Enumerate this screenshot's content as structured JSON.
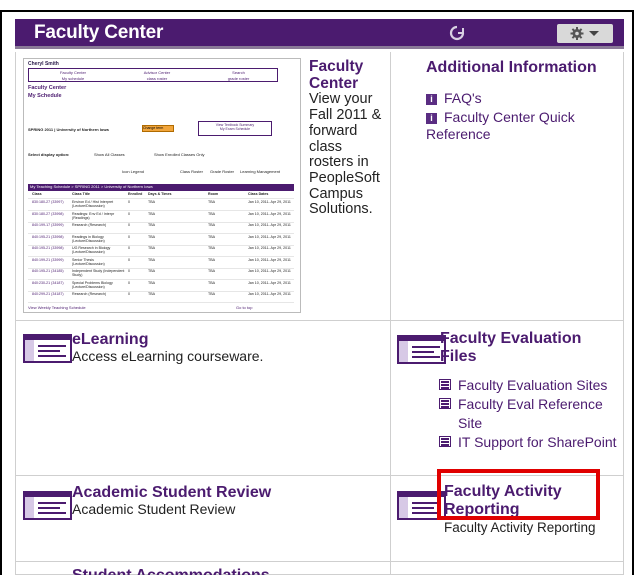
{
  "header": {
    "title": "Faculty Center"
  },
  "thumbnail": {
    "name": "Cheryl Smith",
    "tabs": [
      "Faculty Center",
      "Advisor Center",
      "Search",
      "My schedule",
      "class roster",
      "grade roster"
    ],
    "heading1": "Faculty Center",
    "heading2": "My Schedule",
    "term": "SPRING 2011 | University of Northern Iowa",
    "change_term": "Change term",
    "box1": "View Textbook Summary",
    "box2": "My Exam Schedule",
    "display_option": "Select display option:",
    "opt1": "Show All Classes",
    "opt2": "Show Enrolled Classes Only",
    "legend": "Icon Legend",
    "legend2": "Class Roster",
    "legend3": "Grade Roster",
    "legend4": "Learning Management",
    "table_title": "My Teaching Schedule > SPRING 2011 > University of Northern Iowa",
    "cols": [
      "Class",
      "Class Title",
      "Enrolled",
      "Days & Times",
      "Room",
      "Class Dates"
    ],
    "rows": [
      [
        "830:180-27 (33997)",
        "Environ Ed / Hist Interpret (Lecture/Discussion)",
        "0",
        "TBA",
        "TBA",
        "Jan 10, 2011- Apr 29, 2011"
      ],
      [
        "830:180-27 (33998)",
        "Readings: Env Ed / Interpr (Readings)",
        "0",
        "TBA",
        "TBA",
        "Jan 10, 2011- Apr 29, 2011"
      ],
      [
        "840:199-17 (33999)",
        "Research (Research)",
        "0",
        "TBA",
        "TBA",
        "Jan 10, 2011- Apr 29, 2011"
      ],
      [
        "840:195-21 (33998)",
        "Readings in Biology (Lecture/Discussion)",
        "0",
        "TBA",
        "TBA",
        "Jan 10, 2011- Apr 29, 2011"
      ],
      [
        "840:195-21 (33998)",
        "UG Research in Biology (Lecture/Discussion)",
        "0",
        "TBA",
        "TBA",
        "Jan 10, 2011- Apr 29, 2011"
      ],
      [
        "840:199-21 (33999)",
        "Senior Thesis (Lecture/Discussion)",
        "0",
        "TBA",
        "TBA",
        "Jan 10, 2011- Apr 29, 2011"
      ],
      [
        "840:195-21 (34185)",
        "Independent Study (Independent Study)",
        "0",
        "TBA",
        "TBA",
        "Jan 10, 2011- Apr 29, 2011"
      ],
      [
        "840:230-21 (34187)",
        "Special Problems Biology (Lecture/Discussion)",
        "0",
        "TBA",
        "TBA",
        "Jan 10, 2011- Apr 29, 2011"
      ],
      [
        "840:299-21 (34187)",
        "Research (Research)",
        "0",
        "TBA",
        "TBA",
        "Jan 10, 2011- Apr 29, 2011"
      ]
    ],
    "footer_left": "View Weekly Teaching Schedule",
    "footer_right": "Go to top"
  },
  "faculty_center_desc": {
    "title": "Faculty Center",
    "text": "View your Fall 2011 & forward class rosters in PeopleSoft Campus Solutions."
  },
  "additional_info": {
    "title": "Additional Information",
    "links": [
      "FAQ's",
      "Faculty Center Quick Reference"
    ]
  },
  "elearning": {
    "title": "eLearning",
    "desc": "Access eLearning courseware."
  },
  "faculty_evaluation": {
    "title": "Faculty Evaluation Files",
    "links": [
      "Faculty Evaluation Sites",
      "Faculty Eval Reference Site",
      "IT Support for SharePoint"
    ]
  },
  "academic_student_review": {
    "title": "Academic Student Review",
    "desc": "Academic Student Review"
  },
  "faculty_activity": {
    "title": "Faculty Activity Reporting",
    "desc": "Faculty Activity Reporting"
  },
  "student_accommodations": {
    "title": "Student Accommodations"
  }
}
